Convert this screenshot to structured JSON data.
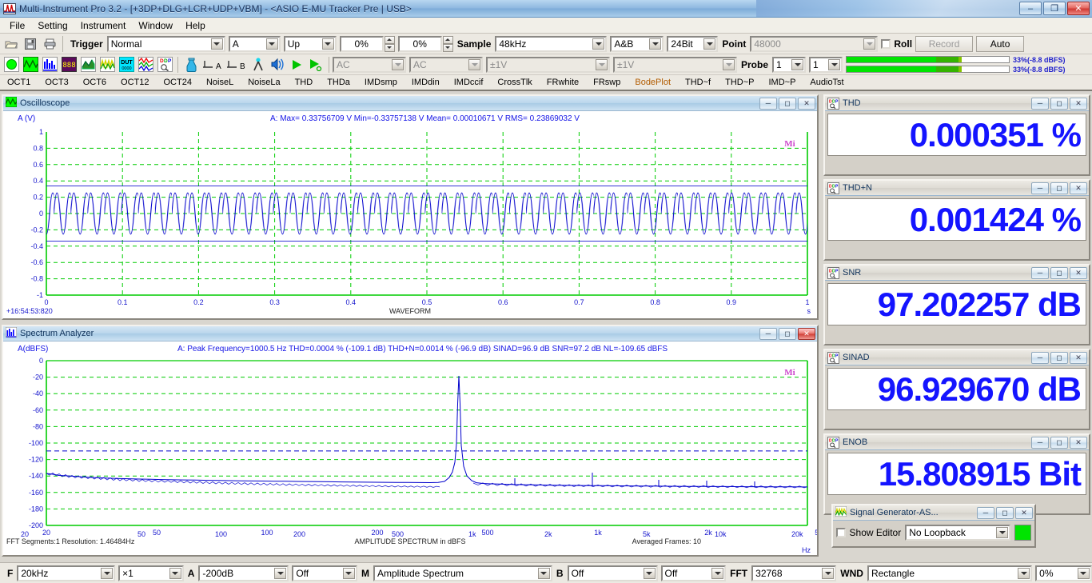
{
  "window": {
    "title": "Multi-Instrument Pro 3.2   -   [+3DP+DLG+LCR+UDP+VBM]   -   <ASIO E-MU Tracker Pre | USB>",
    "minimize": "–",
    "maximize": "❐",
    "close": "✕"
  },
  "menu": [
    "File",
    "Setting",
    "Instrument",
    "Window",
    "Help"
  ],
  "toolbar1": {
    "icons": [
      "open-folder-icon",
      "save-icon",
      "print-icon"
    ],
    "trigger_label": "Trigger",
    "trigger_mode": "Normal",
    "trigger_channel": "A",
    "trigger_edge": "Up",
    "trigger_level": "0%",
    "trigger_delay": "0%",
    "sample_label": "Sample",
    "sample_rate": "48kHz",
    "channel_mode": "A&B",
    "bit_depth": "24Bit",
    "point_label": "Point",
    "point_value": "48000",
    "roll_label": "Roll",
    "record_label": "Record",
    "auto_label": "Auto"
  },
  "toolbar2": {
    "coupling_a": "AC",
    "coupling_b": "AC",
    "range_a": "±1V",
    "range_b": "±1V",
    "probe_label": "Probe",
    "probe_a": "1",
    "probe_b": "1",
    "meter_a_text": "33%(-8.8 dBFS)",
    "meter_b_text": "33%(-8.8 dBFS)",
    "meter_a_pct": 33,
    "meter_b_pct": 33
  },
  "tabs": [
    {
      "label": "OCT1",
      "accent": false
    },
    {
      "label": "OCT3",
      "accent": false
    },
    {
      "label": "OCT6",
      "accent": false
    },
    {
      "label": "OCT12",
      "accent": false
    },
    {
      "label": "OCT24",
      "accent": false
    },
    {
      "label": "NoiseL",
      "accent": false
    },
    {
      "label": "NoiseLa",
      "accent": false
    },
    {
      "label": "THD",
      "accent": false
    },
    {
      "label": "THDa",
      "accent": false
    },
    {
      "label": "IMDsmp",
      "accent": false
    },
    {
      "label": "IMDdin",
      "accent": false
    },
    {
      "label": "IMDccif",
      "accent": false
    },
    {
      "label": "CrossTlk",
      "accent": false
    },
    {
      "label": "FRwhite",
      "accent": false
    },
    {
      "label": "FRswp",
      "accent": false
    },
    {
      "label": "BodePlot",
      "accent": true
    },
    {
      "label": "THD~f",
      "accent": false
    },
    {
      "label": "THD~P",
      "accent": false
    },
    {
      "label": "IMD~P",
      "accent": false
    },
    {
      "label": "AudioTst",
      "accent": false
    }
  ],
  "oscilloscope": {
    "title": "Oscilloscope",
    "ylabel": "A (V)",
    "readout": "A: Max= 0.33756709 V  Min=-0.33757138 V  Mean= 0.00010671 V  RMS= 0.23869032 V",
    "yticks": [
      "1",
      "0.8",
      "0.6",
      "0.4",
      "0.2",
      "0",
      "-0.2",
      "-0.4",
      "-0.6",
      "-0.8",
      "-1"
    ],
    "xticks": [
      "0",
      "0.1",
      "0.2",
      "0.3",
      "0.4",
      "0.5",
      "0.6",
      "0.7",
      "0.8",
      "0.9",
      "1"
    ],
    "timestamp": "+16:54:53:820",
    "footer_center": "WAVEFORM",
    "xunit": "s",
    "watermark": "Mi"
  },
  "spectrum": {
    "title": "Spectrum Analyzer",
    "ylabel": "A(dBFS)",
    "readout": "A: Peak Frequency=1000.5 Hz  THD=0.0004 % (-109.1 dB)  THD+N=0.0014 % (-96.9 dB)  SINAD=96.9 dB  SNR=97.2 dB  NL=-109.65 dBFS",
    "yticks": [
      "0",
      "-20",
      "-40",
      "-60",
      "-80",
      "-100",
      "-120",
      "-140",
      "-160",
      "-180",
      "-200"
    ],
    "xticks": [
      "20",
      "50",
      "100",
      "200",
      "500",
      "1k",
      "2k",
      "5k",
      "10k",
      "20k"
    ],
    "footer_left": "FFT Segments:1   Resolution: 1.46484Hz",
    "footer_center": "AMPLITUDE SPECTRUM in dBFS",
    "footer_right": "Averaged Frames: 10",
    "xunit": "Hz",
    "watermark": "Mi"
  },
  "chart_data": [
    {
      "type": "line",
      "title": "WAVEFORM",
      "xlabel": "s",
      "ylabel": "A (V)",
      "xlim": [
        0,
        1
      ],
      "ylim": [
        -1,
        1
      ],
      "grid": true,
      "series": [
        {
          "name": "A",
          "waveform": "sine",
          "frequency_hz": 1000.5,
          "amplitude_v": 0.3376,
          "mean_v": 0.00010671,
          "rms_v": 0.23869032,
          "color": "#0000cc"
        }
      ]
    },
    {
      "type": "line",
      "title": "AMPLITUDE SPECTRUM in dBFS",
      "xlabel": "Hz",
      "ylabel": "A(dBFS)",
      "xscale": "log",
      "xlim": [
        20,
        20000
      ],
      "ylim": [
        -200,
        0
      ],
      "grid": true,
      "series": [
        {
          "name": "A",
          "peak_frequency_hz": 1000.5,
          "peak_level_dbfs": -8.8,
          "noise_floor_dbfs": -140,
          "noise_level_dbfs": -109.65,
          "color": "#0000cc"
        }
      ]
    }
  ],
  "meters": [
    {
      "name": "THD",
      "value": "0.000351 %"
    },
    {
      "name": "THD+N",
      "value": "0.001424 %"
    },
    {
      "name": "SNR",
      "value": "97.202257 dB"
    },
    {
      "name": "SINAD",
      "value": "96.929670 dB"
    },
    {
      "name": "ENOB",
      "value": "15.808915 Bit"
    }
  ],
  "siggen": {
    "title": "Signal Generator-AS...",
    "show_editor_label": "Show Editor",
    "loopback": "No Loopback"
  },
  "bottombar": {
    "f_label": "F",
    "f_value": "20kHz",
    "mult_value": "×1",
    "a_label": "A",
    "a_value": "-200dB",
    "a_off": "Off",
    "m_label": "M",
    "m_value": "Amplitude Spectrum",
    "b_label": "B",
    "b_value": "Off",
    "b_off": "Off",
    "fft_label": "FFT",
    "fft_value": "32768",
    "wnd_label": "WND",
    "wnd_value": "Rectangle",
    "overlap": "0%"
  },
  "colors": {
    "accent_blue": "#1414ff",
    "grid_green": "#00bb00",
    "trace_blue": "#0000cc",
    "tab_accent": "#b25c00"
  }
}
